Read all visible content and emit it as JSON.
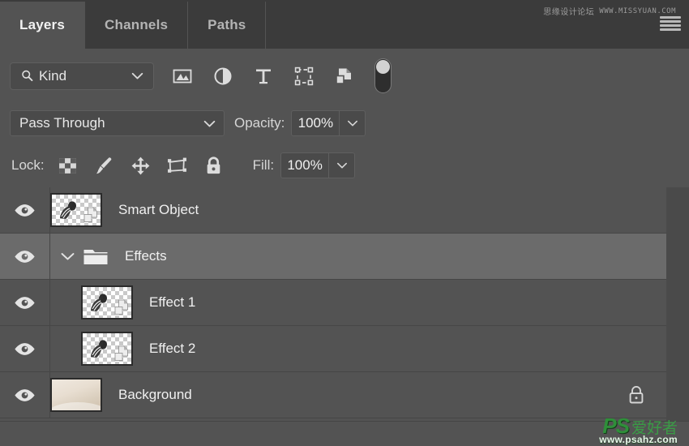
{
  "panel": {
    "title": "Layers",
    "tabs": [
      {
        "label": "Layers",
        "active": true
      },
      {
        "label": "Channels",
        "active": false
      },
      {
        "label": "Paths",
        "active": false
      }
    ],
    "menu_icon": "hamburger-menu-icon"
  },
  "watermarks": {
    "top_cn": "思缘设计论坛",
    "top_url": "WWW.MISSYUAN.COM",
    "bottom_ps": "PS",
    "bottom_cn": "爱好者",
    "bottom_url": "www.psahz.com"
  },
  "filter": {
    "kind_label": "Kind",
    "search_icon": "magnifier-icon",
    "chevron_icon": "chevron-down-icon",
    "icons": [
      {
        "name": "filter-pixel-layers-icon"
      },
      {
        "name": "filter-adjustment-layers-icon"
      },
      {
        "name": "filter-type-layers-icon"
      },
      {
        "name": "filter-shape-layers-icon"
      },
      {
        "name": "filter-smart-object-layers-icon"
      }
    ],
    "toggle_name": "filter-enable-toggle"
  },
  "blend": {
    "mode": "Pass Through",
    "opacity_label": "Opacity:",
    "opacity_value": "100%"
  },
  "lock": {
    "label": "Lock:",
    "icons": [
      {
        "name": "lock-transparent-pixels-icon"
      },
      {
        "name": "lock-image-pixels-icon"
      },
      {
        "name": "lock-position-icon"
      },
      {
        "name": "lock-artboard-nesting-icon"
      },
      {
        "name": "lock-all-icon"
      }
    ],
    "fill_label": "Fill:",
    "fill_value": "100%"
  },
  "layers": [
    {
      "name": "Smart Object",
      "type": "smart-object",
      "visible": true,
      "selected": false,
      "indented": false,
      "locked": false
    },
    {
      "name": "Effects",
      "type": "group",
      "visible": true,
      "selected": true,
      "indented": false,
      "expanded": true,
      "locked": false
    },
    {
      "name": "Effect 1",
      "type": "smart-object",
      "visible": true,
      "selected": false,
      "indented": true,
      "locked": false
    },
    {
      "name": "Effect 2",
      "type": "smart-object",
      "visible": true,
      "selected": false,
      "indented": true,
      "locked": false
    },
    {
      "name": "Background",
      "type": "photo",
      "visible": true,
      "selected": false,
      "indented": false,
      "locked": true
    }
  ],
  "colors": {
    "panel_bg": "#535353",
    "tabbar_bg": "#3b3b3b",
    "selected_row": "#6b6b6b",
    "text": "#f0f0f0",
    "watermark_green": "#2f8f3a"
  }
}
